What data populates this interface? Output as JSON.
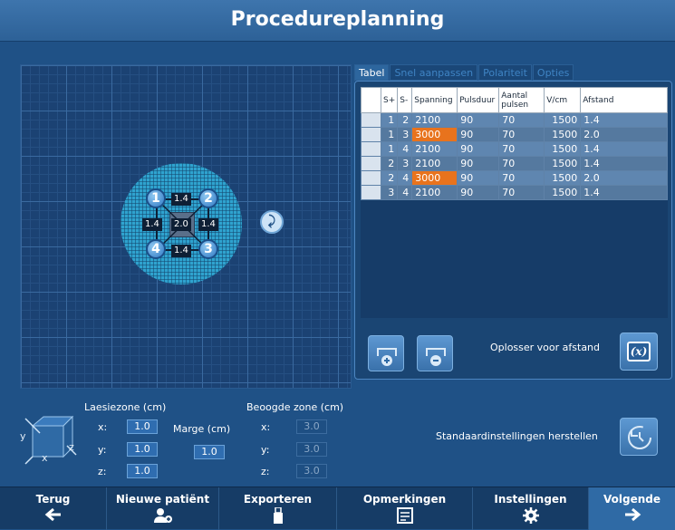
{
  "title": "Procedureplanning",
  "tabs": [
    {
      "label": "Tabel",
      "active": true
    },
    {
      "label": "Snel aanpassen",
      "active": false
    },
    {
      "label": "Polariteit",
      "active": false
    },
    {
      "label": "Opties",
      "active": false
    }
  ],
  "table": {
    "headers": [
      "S+",
      "S-",
      "Spanning",
      "Pulsduur",
      "Aantal pulsen",
      "V/cm",
      "Afstand"
    ],
    "rows": [
      {
        "s_plus": "1",
        "s_minus": "2",
        "spanning": "2100",
        "pulsduur": "90",
        "aantal": "70",
        "vcm": "1500",
        "afstand": "1.4",
        "highlight": false
      },
      {
        "s_plus": "1",
        "s_minus": "3",
        "spanning": "3000",
        "pulsduur": "90",
        "aantal": "70",
        "vcm": "1500",
        "afstand": "2.0",
        "highlight": true
      },
      {
        "s_plus": "1",
        "s_minus": "4",
        "spanning": "2100",
        "pulsduur": "90",
        "aantal": "70",
        "vcm": "1500",
        "afstand": "1.4",
        "highlight": false
      },
      {
        "s_plus": "2",
        "s_minus": "3",
        "spanning": "2100",
        "pulsduur": "90",
        "aantal": "70",
        "vcm": "1500",
        "afstand": "1.4",
        "highlight": false
      },
      {
        "s_plus": "2",
        "s_minus": "4",
        "spanning": "3000",
        "pulsduur": "90",
        "aantal": "70",
        "vcm": "1500",
        "afstand": "2.0",
        "highlight": true
      },
      {
        "s_plus": "3",
        "s_minus": "4",
        "spanning": "2100",
        "pulsduur": "90",
        "aantal": "70",
        "vcm": "1500",
        "afstand": "1.4",
        "highlight": false
      }
    ]
  },
  "grid": {
    "electrodes": [
      "1",
      "2",
      "3",
      "4"
    ],
    "distances": {
      "top": "1.4",
      "left": "1.4",
      "center": "2.0",
      "right": "1.4",
      "bottom": "1.4"
    }
  },
  "solver_label": "Oplosser voor afstand",
  "solver_icon_text": "(x)",
  "lesion_zone": {
    "label": "Laesiezone (cm)",
    "x": "1.0",
    "y": "1.0",
    "z": "1.0"
  },
  "margin": {
    "label": "Marge (cm)",
    "value": "1.0"
  },
  "target_zone": {
    "label": "Beoogde zone (cm)",
    "x": "3.0",
    "y": "3.0",
    "z": "3.0"
  },
  "axis_labels": {
    "x": "x:",
    "y": "y:",
    "z": "z:"
  },
  "cube_axes": {
    "x": "x",
    "y": "y",
    "z": "z"
  },
  "reset_label": "Standaardinstellingen herstellen",
  "nav": {
    "back": "Terug",
    "new_patient": "Nieuwe patiënt",
    "export": "Exporteren",
    "notes": "Opmerkingen",
    "settings": "Instellingen",
    "next": "Volgende"
  },
  "colors": {
    "highlight": "#e8731d",
    "accent": "#2f6db0",
    "background": "#1f5186"
  }
}
